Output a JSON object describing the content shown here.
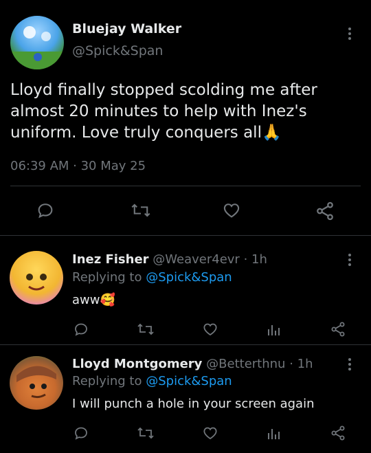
{
  "main_tweet": {
    "display_name": "Bluejay Walker",
    "handle": "@Spick&Span",
    "text": "Lloyd finally stopped scolding me after almost 20 minutes to help with Inez's uniform. Love truly conquers all",
    "emoji": "🙏",
    "timestamp": "06:39 AM · 30 May 25"
  },
  "replies": [
    {
      "display_name": "Inez Fisher",
      "handle": "@Weaver4evr",
      "age": "· 1h",
      "replying_label": "Replying to",
      "replying_to": "@Spick&Span",
      "text": "aww",
      "emoji": "🥰"
    },
    {
      "display_name": "Lloyd Montgomery",
      "handle": "@Betterthnu",
      "age": "· 1h",
      "replying_label": "Replying to",
      "replying_to": "@Spick&Span",
      "text": "I will punch a hole in your screen again",
      "emoji": ""
    }
  ],
  "icons": {
    "reply": "reply-icon",
    "retweet": "retweet-icon",
    "like": "heart-icon",
    "share": "share-icon",
    "analytics": "analytics-icon",
    "more": "more-vertical-icon"
  },
  "colors": {
    "background": "#000000",
    "text": "#e7e9ea",
    "muted": "#71767b",
    "link": "#1d9bf0",
    "divider": "#2f3336"
  }
}
